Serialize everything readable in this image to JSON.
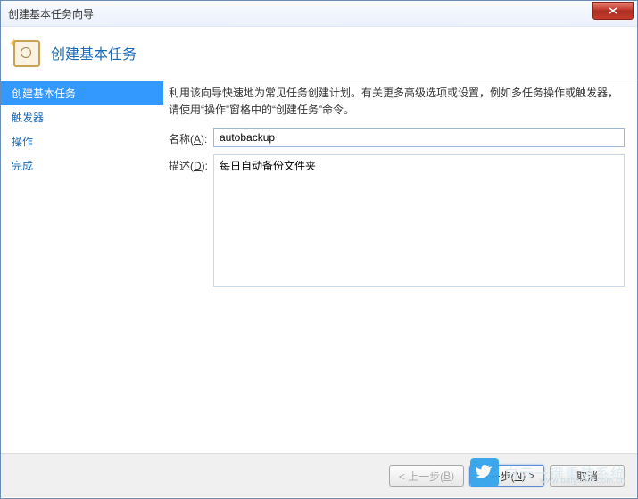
{
  "window": {
    "title": "创建基本任务向导"
  },
  "header": {
    "title": "创建基本任务"
  },
  "sidebar": {
    "items": [
      {
        "label": "创建基本任务",
        "active": true
      },
      {
        "label": "触发器",
        "active": false
      },
      {
        "label": "操作",
        "active": false
      },
      {
        "label": "完成",
        "active": false
      }
    ]
  },
  "main": {
    "instruction": "利用该向导快速地为常见任务创建计划。有关更多高级选项或设置，例如多任务操作或触发器，请使用“操作”窗格中的“创建任务”命令。",
    "name_label_prefix": "名称(",
    "name_label_key": "A",
    "name_label_suffix": "):",
    "name_value": "autobackup",
    "desc_label_prefix": "描述(",
    "desc_label_key": "D",
    "desc_label_suffix": "):",
    "desc_value": "每日自动备份文件夹"
  },
  "footer": {
    "back_prefix": "< 上一步(",
    "back_key": "B",
    "back_suffix": ")",
    "next_prefix": "下一步(",
    "next_key": "N",
    "next_suffix": ") >",
    "cancel": "取消"
  },
  "watermark": {
    "text": "白云一键重装系统",
    "url": "www.baiyunxr.com.cn"
  }
}
